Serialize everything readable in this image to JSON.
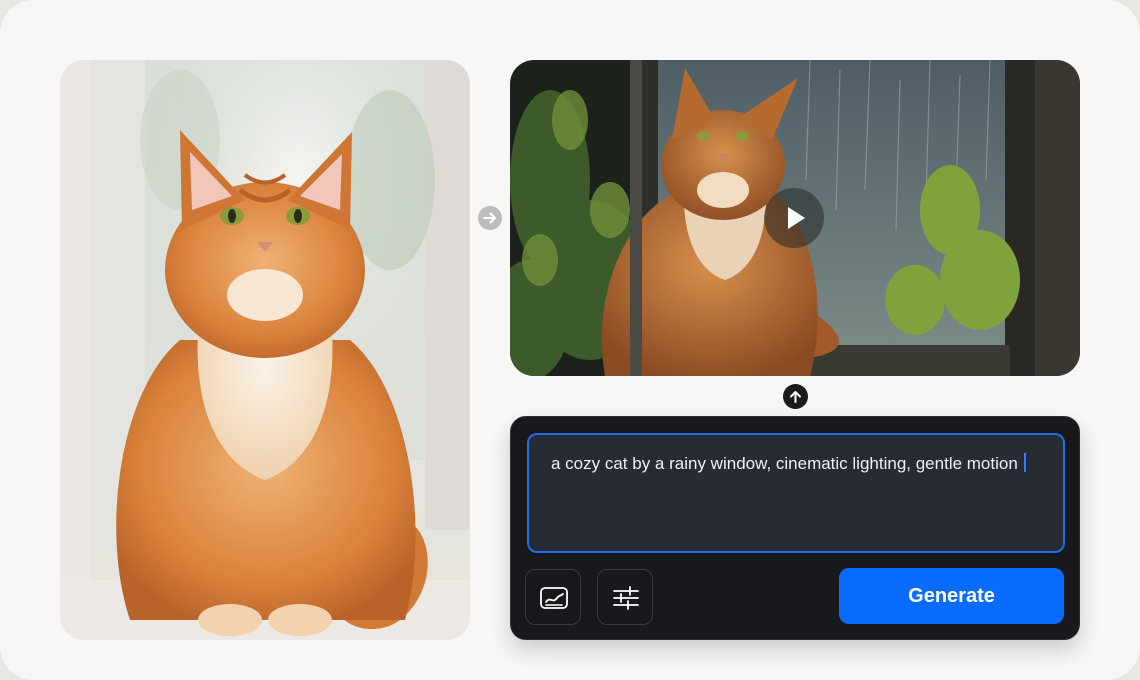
{
  "source_image": {
    "label": "cat-photo-input",
    "accent": "#d9823b"
  },
  "result_video": {
    "label": "cat-rainy-window-video"
  },
  "prompt": {
    "value": "a cozy cat by a rainy window, cinematic lighting, gentle motion"
  },
  "toolbar": {
    "image_icon": "image-chart-icon",
    "settings_icon": "sliders-icon",
    "generate_label": "Generate"
  },
  "icons": {
    "flow_arrow": "arrow-right-icon",
    "upload_arrow": "arrow-up-icon",
    "play": "play-icon"
  },
  "colors": {
    "accent": "#0a6cff",
    "panel": "#18191c",
    "prompt_bg": "#272b34",
    "prompt_border": "#1e6fe6",
    "page_bg": "#f8f7f5"
  }
}
